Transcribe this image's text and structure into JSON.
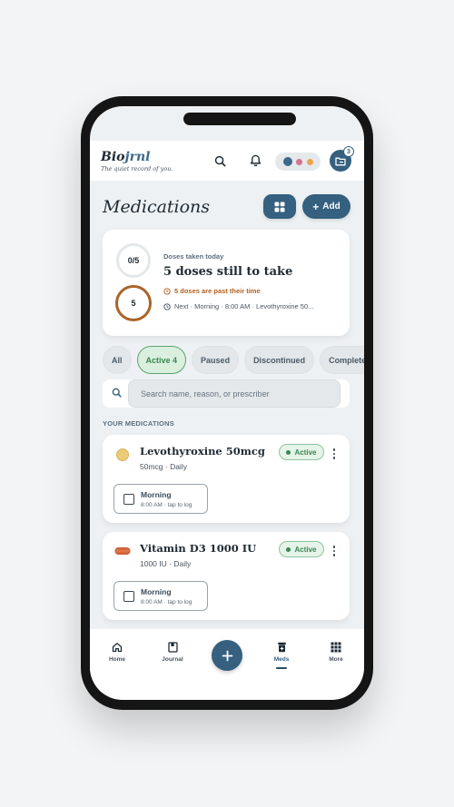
{
  "brand": {
    "name_main": "Bio",
    "name_accent": "jrnl",
    "tagline": "The quiet record of you."
  },
  "header": {
    "notification_count": "3",
    "dot_colors": [
      "#3d6a8a",
      "#d2748c",
      "#e9a54a"
    ]
  },
  "page": {
    "title": "Medications",
    "add_label": "Add"
  },
  "summary": {
    "taken": "0/5",
    "past_count": "5",
    "kicker": "Doses taken today",
    "headline": "5 doses still to take",
    "warning": "5 doses are past their time",
    "next": "Next · Morning · 8:00 AM · Levothyroxine 50..."
  },
  "filters": [
    {
      "label": "All"
    },
    {
      "label": "Active 4"
    },
    {
      "label": "Paused"
    },
    {
      "label": "Discontinued"
    },
    {
      "label": "Completed"
    }
  ],
  "search": {
    "placeholder": "Search name, reason, or prescriber"
  },
  "section_label": "YOUR MEDICATIONS",
  "medications": [
    {
      "name": "Levothyroxine 50mcg",
      "detail": "50mcg · Daily",
      "status": "Active",
      "dose_label": "Morning",
      "dose_time": "8:00 AM · tap to log",
      "pill_color": "#eccb78"
    },
    {
      "name": "Vitamin D3 1000 IU",
      "detail": "1000 IU · Daily",
      "status": "Active",
      "dose_label": "Morning",
      "dose_time": "8:00 AM · tap to log",
      "pill_color": "#d9693f"
    }
  ],
  "nav": [
    {
      "label": "Home"
    },
    {
      "label": "Journal"
    },
    {
      "label": "Meds"
    },
    {
      "label": "More"
    }
  ],
  "colors": {
    "primary": "#35607f",
    "active_green": "#37894f",
    "warning": "#b3611f"
  }
}
